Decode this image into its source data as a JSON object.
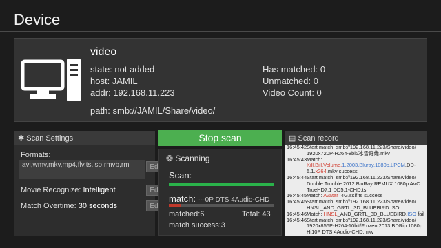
{
  "header": {
    "title": "Device"
  },
  "device": {
    "name": "video",
    "state": "state: not added",
    "host": "host: JAMIL",
    "addr": "addr: 192.168.11.223",
    "path": "path: smb://JAMIL/Share/video/",
    "has_matched": "Has matched: 0",
    "unmatched": "Unmatched: 0",
    "video_count": "Video Count: 0",
    "icon": "computer-icon"
  },
  "settings": {
    "title": "Scan Settings",
    "formats_label": "Formats:",
    "formats_value": "avi,wmv,mkv,mp4,flv,ts,iso,rmvb,rm",
    "edit_label": "Edit",
    "movie_recognize_label": "Movie Recognize:",
    "movie_recognize_value": "Intelligent",
    "match_overtime_label": "Match Overtime:",
    "match_overtime_value": "30 seconds"
  },
  "scan": {
    "stop_button": "Stop scan",
    "status": "Scanning",
    "scan_label": "Scan:",
    "scan_progress": 1.0,
    "match_label": "match:",
    "match_file": "···0P DTS 4Audio-CHD",
    "match_progress": 0.12,
    "matched": "matched:6",
    "total": "Total: 43",
    "success": "match success:3",
    "colors": {
      "progress": "#2ab24a",
      "match": "#c0392b",
      "button": "#4caf50"
    }
  },
  "record": {
    "title": "Scan record",
    "entries": [
      {
        "time": "16:45:42",
        "parts": [
          {
            "t": "Start match: smb://192.168.11.223/Share/video/ 1920x720P-H264-8bit/冰雪奇缘.mkv",
            "c": ""
          }
        ]
      },
      {
        "time": "16:45:43",
        "parts": [
          {
            "t": "Match: ",
            "c": ""
          },
          {
            "t": "Kill.Bill.Volume.",
            "c": "red"
          },
          {
            "t": "1.2003.Bluray.",
            "c": "blue"
          },
          {
            "t": "1080p.LPCM",
            "c": "blue"
          },
          {
            "t": ".DD-5.1.",
            "c": ""
          },
          {
            "t": "x264",
            "c": "red"
          },
          {
            "t": ".mkv success",
            "c": ""
          }
        ]
      },
      {
        "time": "16:45:44",
        "parts": [
          {
            "t": "Start match: smb://192.168.11.223/Share/video/ Double Trouble 2012 BluRay REMUX 1080p AVC TrueHD7.1 DD5.1-CHD.ts",
            "c": ""
          }
        ]
      },
      {
        "time": "16:45:45",
        "parts": [
          {
            "t": "Match: ",
            "c": ""
          },
          {
            "t": "Avatar",
            "c": "red"
          },
          {
            "t": "_4G.ssif.ts success",
            "c": ""
          }
        ]
      },
      {
        "time": "16:45:45",
        "parts": [
          {
            "t": "Start match: smb://192.168.11.223/Share/video/ HNSL_AND_GRTL_3D_BLUEBIRD.ISO",
            "c": ""
          }
        ]
      },
      {
        "time": "16:45:46",
        "parts": [
          {
            "t": "Match: ",
            "c": ""
          },
          {
            "t": "HNSL",
            "c": "red"
          },
          {
            "t": "_AND_GRTL_3D_BLUEBIRD.",
            "c": ""
          },
          {
            "t": "ISO",
            "c": "blue"
          },
          {
            "t": " fail",
            "c": ""
          }
        ]
      },
      {
        "time": "16:45:46",
        "parts": [
          {
            "t": "Start match: smb://192.168.11.223/Share/video/ 1920x856P-H264-10bit/Frozen 2013 BDRip 1080p Hi10P DTS 4Audio-CHD.mkv",
            "c": ""
          }
        ]
      }
    ]
  }
}
